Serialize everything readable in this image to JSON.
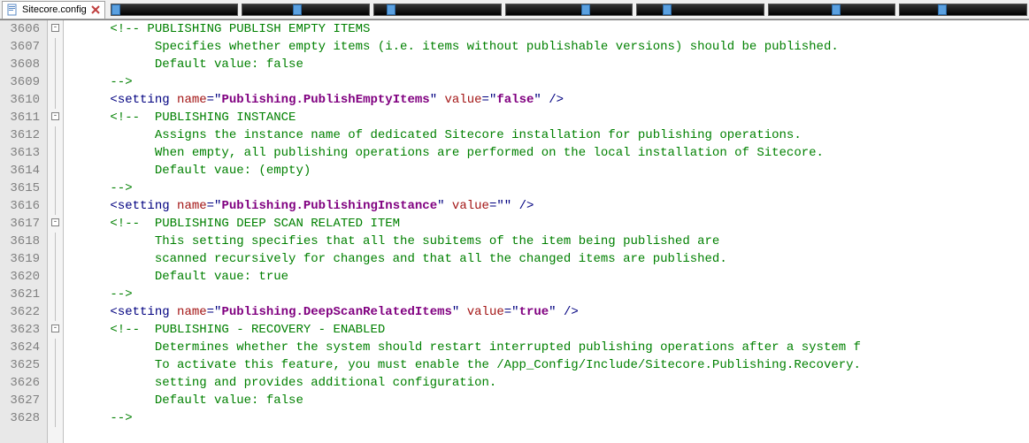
{
  "tab": {
    "filename": "Sitecore.config"
  },
  "lines": [
    {
      "n": 3606,
      "fold": "minus",
      "seg": [
        {
          "cls": "c-comment",
          "t": "      <!-- PUBLISHING PUBLISH EMPTY ITEMS"
        }
      ]
    },
    {
      "n": 3607,
      "fold": "line",
      "seg": [
        {
          "cls": "c-comment",
          "t": "            Specifies whether empty items (i.e. items without publishable versions) should be published."
        }
      ]
    },
    {
      "n": 3608,
      "fold": "line",
      "seg": [
        {
          "cls": "c-comment",
          "t": "            Default value: false"
        }
      ]
    },
    {
      "n": 3609,
      "fold": "line",
      "seg": [
        {
          "cls": "c-comment",
          "t": "      -->"
        }
      ]
    },
    {
      "n": 3610,
      "fold": "line",
      "seg": [
        {
          "cls": "",
          "t": "      "
        },
        {
          "cls": "c-d",
          "t": "<"
        },
        {
          "cls": "c-tag",
          "t": "setting"
        },
        {
          "cls": "",
          "t": " "
        },
        {
          "cls": "c-attr",
          "t": "name"
        },
        {
          "cls": "c-op",
          "t": "=\""
        },
        {
          "cls": "c-value",
          "t": "Publishing.PublishEmptyItems"
        },
        {
          "cls": "c-op",
          "t": "\""
        },
        {
          "cls": "",
          "t": " "
        },
        {
          "cls": "c-attr",
          "t": "value"
        },
        {
          "cls": "c-op",
          "t": "=\""
        },
        {
          "cls": "c-value",
          "t": "false"
        },
        {
          "cls": "c-op",
          "t": "\""
        },
        {
          "cls": "",
          "t": " "
        },
        {
          "cls": "c-d",
          "t": "/>"
        }
      ]
    },
    {
      "n": 3611,
      "fold": "minus",
      "seg": [
        {
          "cls": "c-comment",
          "t": "      <!--  PUBLISHING INSTANCE"
        }
      ]
    },
    {
      "n": 3612,
      "fold": "line",
      "seg": [
        {
          "cls": "c-comment",
          "t": "            Assigns the instance name of dedicated Sitecore installation for publishing operations."
        }
      ]
    },
    {
      "n": 3613,
      "fold": "line",
      "seg": [
        {
          "cls": "c-comment",
          "t": "            When empty, all publishing operations are performed on the local installation of Sitecore."
        }
      ]
    },
    {
      "n": 3614,
      "fold": "line",
      "seg": [
        {
          "cls": "c-comment",
          "t": "            Default vaue: (empty)"
        }
      ]
    },
    {
      "n": 3615,
      "fold": "line",
      "seg": [
        {
          "cls": "c-comment",
          "t": "      -->"
        }
      ]
    },
    {
      "n": 3616,
      "fold": "line",
      "seg": [
        {
          "cls": "",
          "t": "      "
        },
        {
          "cls": "c-d",
          "t": "<"
        },
        {
          "cls": "c-tag",
          "t": "setting"
        },
        {
          "cls": "",
          "t": " "
        },
        {
          "cls": "c-attr",
          "t": "name"
        },
        {
          "cls": "c-op",
          "t": "=\""
        },
        {
          "cls": "c-value",
          "t": "Publishing.PublishingInstance"
        },
        {
          "cls": "c-op",
          "t": "\""
        },
        {
          "cls": "",
          "t": " "
        },
        {
          "cls": "c-attr",
          "t": "value"
        },
        {
          "cls": "c-op",
          "t": "=\""
        },
        {
          "cls": "c-value",
          "t": ""
        },
        {
          "cls": "c-op",
          "t": "\""
        },
        {
          "cls": "",
          "t": " "
        },
        {
          "cls": "c-d",
          "t": "/>"
        }
      ]
    },
    {
      "n": 3617,
      "fold": "minus",
      "seg": [
        {
          "cls": "c-comment",
          "t": "      <!--  PUBLISHING DEEP SCAN RELATED ITEM"
        }
      ]
    },
    {
      "n": 3618,
      "fold": "line",
      "seg": [
        {
          "cls": "c-comment",
          "t": "            This setting specifies that all the subitems of the item being published are"
        }
      ]
    },
    {
      "n": 3619,
      "fold": "line",
      "seg": [
        {
          "cls": "c-comment",
          "t": "            scanned recursively for changes and that all the changed items are published."
        }
      ]
    },
    {
      "n": 3620,
      "fold": "line",
      "seg": [
        {
          "cls": "c-comment",
          "t": "            Default vaue: true"
        }
      ]
    },
    {
      "n": 3621,
      "fold": "line",
      "seg": [
        {
          "cls": "c-comment",
          "t": "      -->"
        }
      ]
    },
    {
      "n": 3622,
      "fold": "line",
      "seg": [
        {
          "cls": "",
          "t": "      "
        },
        {
          "cls": "c-d",
          "t": "<"
        },
        {
          "cls": "c-tag",
          "t": "setting"
        },
        {
          "cls": "",
          "t": " "
        },
        {
          "cls": "c-attr",
          "t": "name"
        },
        {
          "cls": "c-op",
          "t": "=\""
        },
        {
          "cls": "c-value",
          "t": "Publishing.DeepScanRelatedItems"
        },
        {
          "cls": "c-op",
          "t": "\""
        },
        {
          "cls": "",
          "t": " "
        },
        {
          "cls": "c-attr",
          "t": "value"
        },
        {
          "cls": "c-op",
          "t": "=\""
        },
        {
          "cls": "c-value",
          "t": "true"
        },
        {
          "cls": "c-op",
          "t": "\""
        },
        {
          "cls": "",
          "t": " "
        },
        {
          "cls": "c-d",
          "t": "/>"
        }
      ]
    },
    {
      "n": 3623,
      "fold": "minus",
      "seg": [
        {
          "cls": "c-comment",
          "t": "      <!--  PUBLISHING - RECOVERY - ENABLED"
        }
      ]
    },
    {
      "n": 3624,
      "fold": "line",
      "seg": [
        {
          "cls": "c-comment",
          "t": "            Determines whether the system should restart interrupted publishing operations after a system f"
        }
      ]
    },
    {
      "n": 3625,
      "fold": "line",
      "seg": [
        {
          "cls": "c-comment",
          "t": "            To activate this feature, you must enable the /App_Config/Include/Sitecore.Publishing.Recovery."
        }
      ]
    },
    {
      "n": 3626,
      "fold": "line",
      "seg": [
        {
          "cls": "c-comment",
          "t": "            setting and provides additional configuration."
        }
      ]
    },
    {
      "n": 3627,
      "fold": "line",
      "seg": [
        {
          "cls": "c-comment",
          "t": "            Default value: false"
        }
      ]
    },
    {
      "n": 3628,
      "fold": "line",
      "seg": [
        {
          "cls": "c-comment",
          "t": "      -->"
        }
      ]
    }
  ]
}
